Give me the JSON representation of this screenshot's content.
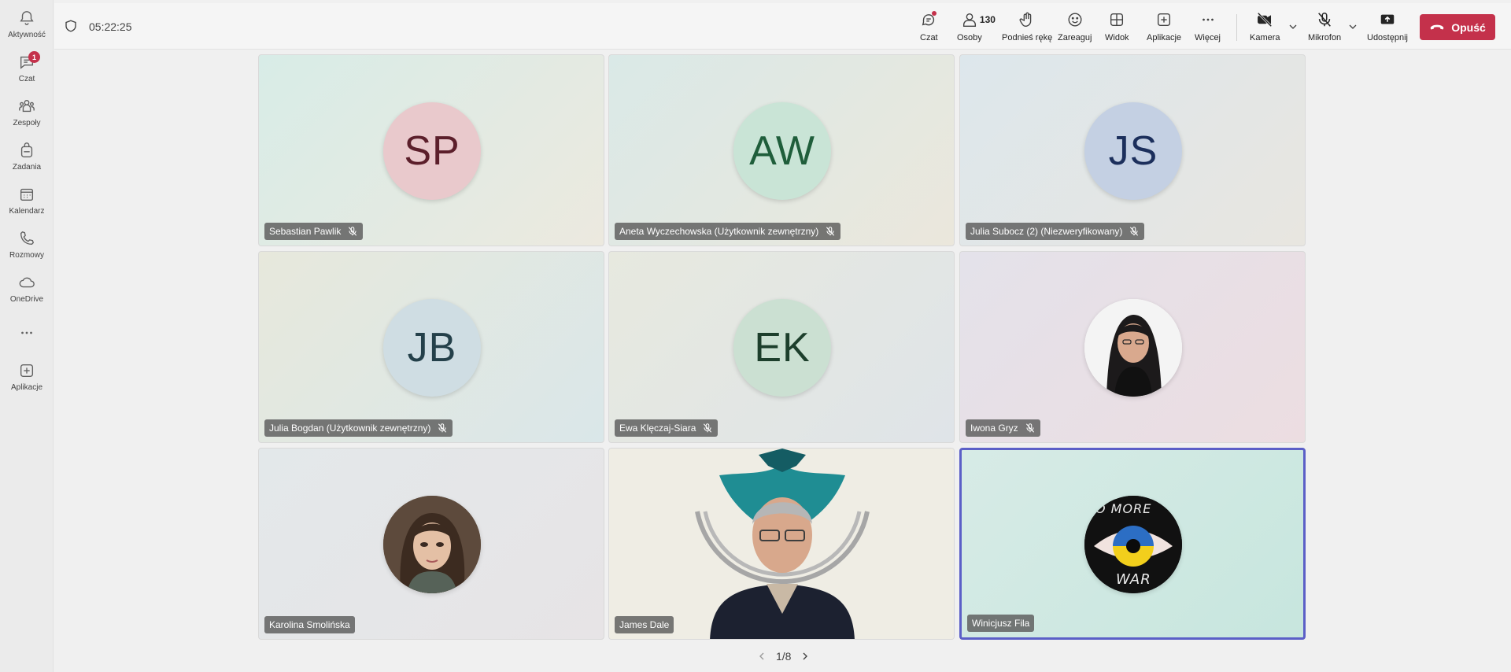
{
  "rail": {
    "items": [
      {
        "label": "Aktywność",
        "icon": "bell-icon"
      },
      {
        "label": "Czat",
        "icon": "chat-icon",
        "badge": "1"
      },
      {
        "label": "Zespoły",
        "icon": "teams-icon"
      },
      {
        "label": "Zadania",
        "icon": "backpack-icon"
      },
      {
        "label": "Kalendarz",
        "icon": "calendar-icon"
      },
      {
        "label": "Rozmowy",
        "icon": "phone-icon"
      },
      {
        "label": "OneDrive",
        "icon": "cloud-icon"
      },
      {
        "label": "Aplikacje",
        "icon": "add-app-icon"
      }
    ]
  },
  "topbar": {
    "timer": "05:22:25",
    "buttons": {
      "chat": "Czat",
      "people": "Osoby",
      "people_count": "130",
      "raise_hand": "Podnieś rękę",
      "react": "Zareaguj",
      "view": "Widok",
      "apps": "Aplikacje",
      "more": "Więcej",
      "camera": "Kamera",
      "mic": "Mikrofon",
      "share": "Udostępnij"
    },
    "leave": "Opuść"
  },
  "participants": [
    {
      "name": "Sebastian Pawlik",
      "initials": "SP",
      "muted": true
    },
    {
      "name": "Aneta Wyczechowska (Użytkownik zewnętrzny)",
      "initials": "AW",
      "muted": true
    },
    {
      "name": "Julia Subocz (2) (Niezweryfikowany)",
      "initials": "JS",
      "muted": true
    },
    {
      "name": "Julia Bogdan (Użytkownik zewnętrzny)",
      "initials": "JB",
      "muted": true
    },
    {
      "name": "Ewa Klęczaj-Siara",
      "initials": "EK",
      "muted": true
    },
    {
      "name": "Iwona Gryz",
      "initials": "",
      "muted": true
    },
    {
      "name": "Karolina Smolińska",
      "initials": "",
      "muted": false
    },
    {
      "name": "James Dale",
      "initials": "",
      "muted": false
    },
    {
      "name": "Winicjusz Fila",
      "initials": "",
      "muted": false
    }
  ],
  "pager": {
    "label": "1/8"
  },
  "colors": {
    "accent": "#5b5fc7",
    "leave": "#c4314b",
    "badge": "#c4314b"
  }
}
